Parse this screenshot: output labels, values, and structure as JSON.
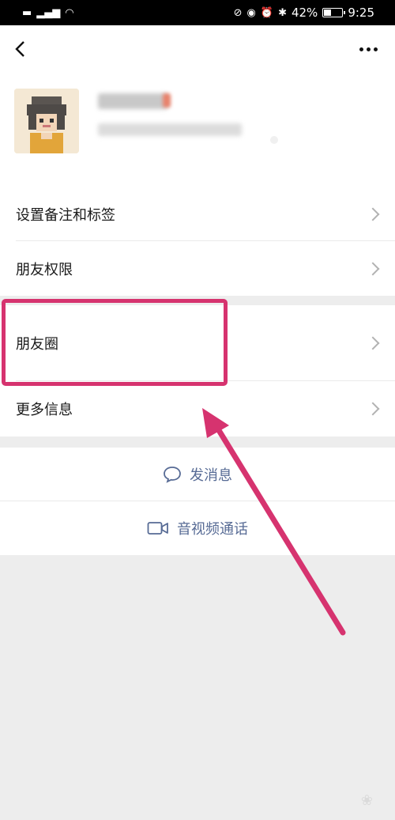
{
  "status_bar": {
    "left_icons": [
      "sim-icon",
      "signal-icon",
      "wifi-icon"
    ],
    "right_icons": [
      "nfc-icon",
      "eye-icon",
      "alarm-icon",
      "bluetooth-icon"
    ],
    "battery_level": 0.42,
    "battery_text": "42%",
    "time": "9:25"
  },
  "header": {
    "back_icon": "chevron-left-icon",
    "more_icon": "more-dots-icon"
  },
  "profile": {
    "avatar": "pixel-avatar"
  },
  "menu": {
    "remark_tags": "设置备注和标签",
    "friend_permission": "朋友权限",
    "moments": "朋友圈",
    "more_info": "更多信息"
  },
  "actions": {
    "send_message": "发消息",
    "video_call": "音视频通话"
  },
  "colors": {
    "link_blue": "#576b95",
    "highlight_pink": "#d6336f",
    "background_gray": "#ededed"
  }
}
